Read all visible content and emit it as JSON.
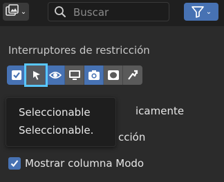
{
  "header": {
    "search": {
      "placeholder": "Buscar",
      "value": ""
    }
  },
  "restriction_toggles": {
    "title": "Interruptores de restricción",
    "items": [
      {
        "name": "exclude-checkbox",
        "icon": "checkbox-icon",
        "state": "on"
      },
      {
        "name": "selectable",
        "icon": "cursor-arrow-icon",
        "state": "on",
        "hovered": true
      },
      {
        "name": "hide-in-viewport",
        "icon": "eye-icon",
        "state": "on"
      },
      {
        "name": "disable-in-viewports",
        "icon": "monitor-icon",
        "state": "off"
      },
      {
        "name": "disable-in-renders",
        "icon": "camera-icon",
        "state": "on"
      },
      {
        "name": "holdout",
        "icon": "holdout-icon",
        "state": "off"
      },
      {
        "name": "indirect-only",
        "icon": "indirect-arrow-icon",
        "state": "off"
      }
    ]
  },
  "options": [
    {
      "label_partial": "icamente",
      "checked": true
    },
    {
      "label_partial": "cción",
      "checked": true
    },
    {
      "label": "Mostrar columna Modo",
      "checked": true
    }
  ],
  "tooltip": {
    "title": "Seleccionable",
    "description": "Seleccionable."
  },
  "colors": {
    "accent": "#4772b3",
    "highlight": "#59c7ff",
    "background": "#2b2b2b"
  }
}
